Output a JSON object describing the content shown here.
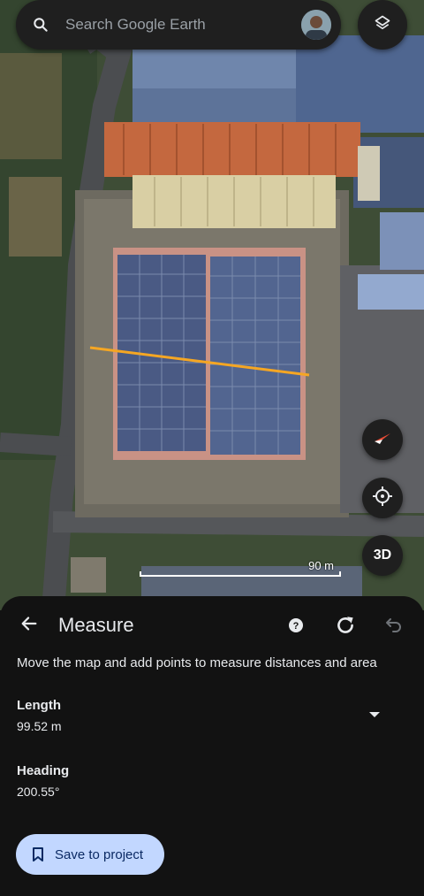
{
  "search": {
    "placeholder": "Search Google Earth"
  },
  "icons": {
    "search": "search-icon",
    "layers": "layers-icon",
    "compass": "compass-icon",
    "location": "my-location-icon",
    "back": "arrow-back-icon",
    "help": "help-icon",
    "refresh": "refresh-icon",
    "undo": "undo-icon",
    "dropdown": "dropdown-arrow-icon",
    "bookmark": "bookmark-icon"
  },
  "map": {
    "scale_label": "90 m",
    "view_3d_label": "3D",
    "measure_line_color": "#f5a623"
  },
  "measure": {
    "title": "Measure",
    "instruction": "Move the map and add points to measure distances and area",
    "length_label": "Length",
    "length_value": "99.52 m",
    "heading_label": "Heading",
    "heading_value": "200.55°",
    "save_label": "Save to project"
  },
  "colors": {
    "sheet_bg": "#121212",
    "save_button_bg": "#c2d7ff",
    "save_button_text": "#0b2a63"
  }
}
